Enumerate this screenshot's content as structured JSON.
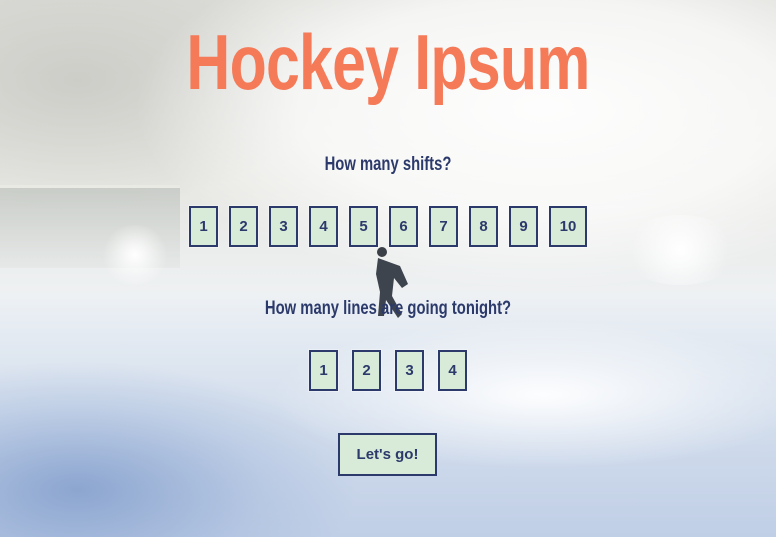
{
  "header": {
    "title": "Hockey Ipsum"
  },
  "shifts": {
    "question": "How many shifts?",
    "options": [
      "1",
      "2",
      "3",
      "4",
      "5",
      "6",
      "7",
      "8",
      "9",
      "10"
    ]
  },
  "lines": {
    "question": "How many lines are going tonight?",
    "options": [
      "1",
      "2",
      "3",
      "4"
    ]
  },
  "submit": {
    "label": "Let's go!"
  },
  "colors": {
    "title": "#f57a58",
    "text": "#2c3a6b",
    "button_bg": "#d8ead8"
  }
}
